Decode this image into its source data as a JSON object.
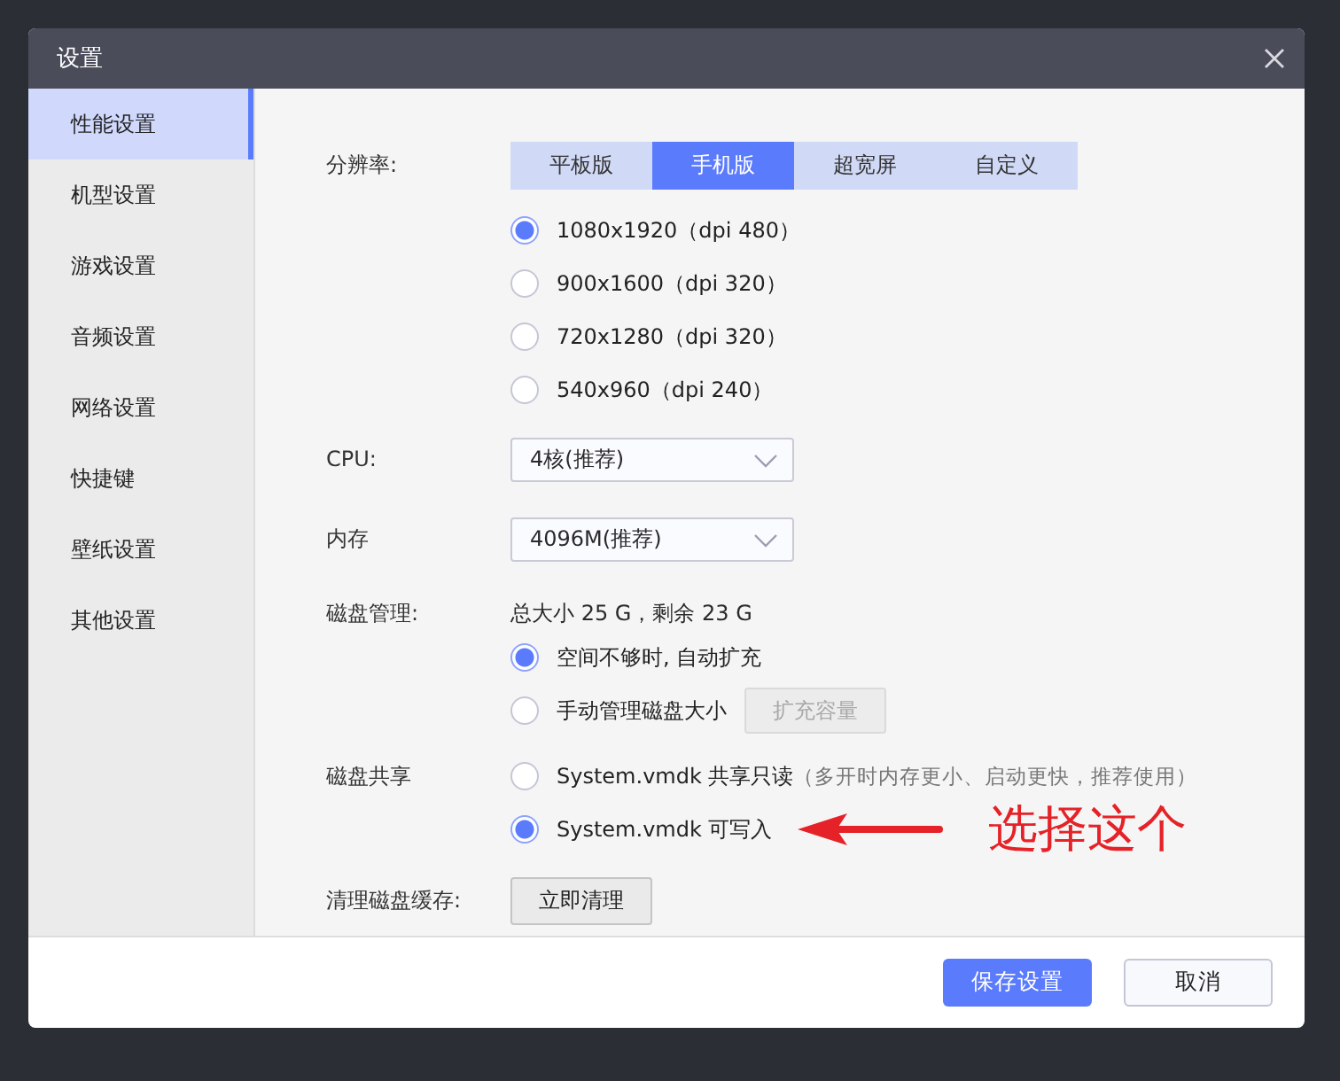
{
  "window": {
    "title": "设置"
  },
  "sidebar": {
    "items": [
      {
        "label": "性能设置",
        "selected": true
      },
      {
        "label": "机型设置",
        "selected": false
      },
      {
        "label": "游戏设置",
        "selected": false
      },
      {
        "label": "音频设置",
        "selected": false
      },
      {
        "label": "网络设置",
        "selected": false
      },
      {
        "label": "快捷键",
        "selected": false
      },
      {
        "label": "壁纸设置",
        "selected": false
      },
      {
        "label": "其他设置",
        "selected": false
      }
    ]
  },
  "resolution": {
    "label": "分辨率:",
    "tabs": [
      {
        "label": "平板版",
        "selected": false
      },
      {
        "label": "手机版",
        "selected": true
      },
      {
        "label": "超宽屏",
        "selected": false
      },
      {
        "label": "自定义",
        "selected": false
      }
    ],
    "options": [
      {
        "label": "1080x1920（dpi 480）",
        "selected": true
      },
      {
        "label": "900x1600（dpi 320）",
        "selected": false
      },
      {
        "label": "720x1280（dpi 320）",
        "selected": false
      },
      {
        "label": "540x960（dpi 240）",
        "selected": false
      }
    ]
  },
  "cpu": {
    "label": "CPU:",
    "value": "4核(推荐)"
  },
  "memory": {
    "label": "内存",
    "value": "4096M(推荐)"
  },
  "disk": {
    "label": "磁盘管理:",
    "info": "总大小 25 G，剩余 23 G",
    "options": [
      {
        "label": "空间不够时, 自动扩充",
        "selected": true
      },
      {
        "label": "手动管理磁盘大小",
        "selected": false,
        "button": {
          "label": "扩充容量",
          "disabled": true
        }
      }
    ]
  },
  "disk_share": {
    "label": "磁盘共享",
    "options": [
      {
        "label": "System.vmdk 共享只读",
        "note": "（多开时内存更小、启动更快，推荐使用）",
        "selected": false
      },
      {
        "label": "System.vmdk 可写入",
        "selected": true,
        "annotation": "选择这个"
      }
    ]
  },
  "clear_cache": {
    "label": "清理磁盘缓存:",
    "button": "立即清理"
  },
  "buttons": [
    {
      "label": "保存设置",
      "kind": "primary"
    },
    {
      "label": "取消",
      "kind": "secondary"
    }
  ]
}
